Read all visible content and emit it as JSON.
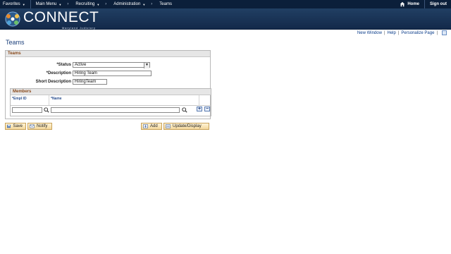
{
  "topnav": {
    "favorites": "Favorites",
    "main_menu": "Main Menu",
    "breadcrumbs": [
      "Recruiting",
      "Administration",
      "Teams"
    ],
    "home": "Home",
    "sign_out": "Sign out"
  },
  "banner": {
    "brand": "CONNECT",
    "subtitle": "Maryland Judiciary"
  },
  "utilities": {
    "new_window": "New Window",
    "help": "Help",
    "personalize": "Personalize Page"
  },
  "page_title": "Teams",
  "teams_group": {
    "heading": "Teams",
    "status_label": "*Status",
    "status_value": "Active",
    "description_label": "*Description",
    "description_value": "Hiring Team",
    "short_description_label": "Short Description",
    "short_description_value": "HiringTeam"
  },
  "members": {
    "heading": "Members",
    "columns": [
      "*Empl ID",
      "*Name"
    ],
    "row": {
      "empl_id": "",
      "name": ""
    },
    "add_row": "+",
    "delete_row": "−"
  },
  "toolbar": {
    "save": "Save",
    "notify": "Notify",
    "add": "Add",
    "update_display": "Update/Display"
  },
  "colors": {
    "nav_bg": "#0b1f3a",
    "banner_bg": "#1b365d",
    "link": "#0a3c8a",
    "section_heading": "#8a4b1d",
    "button_bg": "#f3d79b"
  }
}
